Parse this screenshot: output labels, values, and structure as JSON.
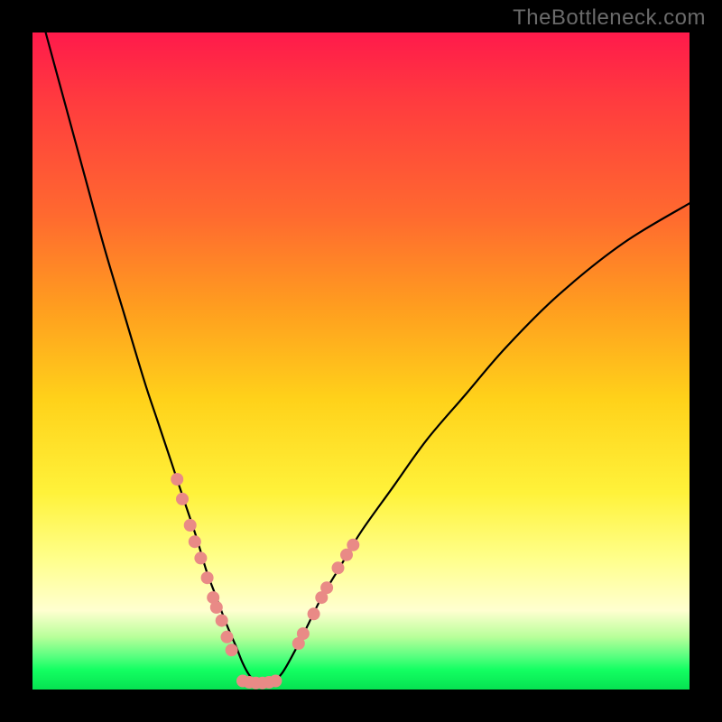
{
  "watermark": "TheBottleneck.com",
  "chart_data": {
    "type": "line",
    "title": "",
    "xlabel": "",
    "ylabel": "",
    "xlim": [
      0,
      100
    ],
    "ylim": [
      0,
      100
    ],
    "grid": false,
    "legend": false,
    "background_gradient": {
      "stops": [
        {
          "pos": 0.0,
          "color": "#ff1a4b"
        },
        {
          "pos": 0.1,
          "color": "#ff3a3f"
        },
        {
          "pos": 0.28,
          "color": "#ff6a2f"
        },
        {
          "pos": 0.42,
          "color": "#ff9e1f"
        },
        {
          "pos": 0.56,
          "color": "#ffd21a"
        },
        {
          "pos": 0.7,
          "color": "#fff23a"
        },
        {
          "pos": 0.8,
          "color": "#ffff8a"
        },
        {
          "pos": 0.88,
          "color": "#ffffd0"
        },
        {
          "pos": 0.92,
          "color": "#b8ff9a"
        },
        {
          "pos": 0.95,
          "color": "#57ff7f"
        },
        {
          "pos": 0.97,
          "color": "#13ff62"
        },
        {
          "pos": 1.0,
          "color": "#06e251"
        }
      ]
    },
    "series": [
      {
        "name": "bottleneck-curve",
        "stroke": "#000000",
        "x": [
          2,
          5,
          8,
          11,
          14,
          17,
          19,
          21,
          23,
          25,
          26.5,
          28,
          29.5,
          31,
          32,
          33,
          34,
          35,
          36.5,
          38,
          40,
          42,
          44,
          47,
          50,
          55,
          60,
          66,
          72,
          80,
          90,
          100
        ],
        "y": [
          100,
          89,
          78,
          67,
          57,
          47,
          41,
          35,
          29,
          23,
          18,
          14,
          10,
          6.5,
          4,
          2.2,
          1.2,
          1.0,
          1.2,
          2.5,
          6,
          10,
          14,
          19,
          24,
          31,
          38,
          45,
          52,
          60,
          68,
          74
        ]
      }
    ],
    "scatter_overlay": {
      "name": "marker-dots",
      "color": "#e98a86",
      "radius_px": 7,
      "points": [
        {
          "x": 22.0,
          "y": 32
        },
        {
          "x": 22.8,
          "y": 29
        },
        {
          "x": 24.0,
          "y": 25
        },
        {
          "x": 24.7,
          "y": 22.5
        },
        {
          "x": 25.6,
          "y": 20
        },
        {
          "x": 26.6,
          "y": 17
        },
        {
          "x": 27.5,
          "y": 14
        },
        {
          "x": 28.0,
          "y": 12.5
        },
        {
          "x": 28.8,
          "y": 10.5
        },
        {
          "x": 29.6,
          "y": 8
        },
        {
          "x": 30.3,
          "y": 6
        },
        {
          "x": 32.0,
          "y": 1.3
        },
        {
          "x": 33.0,
          "y": 1.1
        },
        {
          "x": 34.0,
          "y": 1.0
        },
        {
          "x": 35.0,
          "y": 1.0
        },
        {
          "x": 36.0,
          "y": 1.1
        },
        {
          "x": 37.0,
          "y": 1.3
        },
        {
          "x": 40.5,
          "y": 7
        },
        {
          "x": 41.2,
          "y": 8.5
        },
        {
          "x": 42.8,
          "y": 11.5
        },
        {
          "x": 44.0,
          "y": 14
        },
        {
          "x": 44.8,
          "y": 15.5
        },
        {
          "x": 46.5,
          "y": 18.5
        },
        {
          "x": 47.8,
          "y": 20.5
        },
        {
          "x": 48.8,
          "y": 22
        }
      ]
    }
  }
}
